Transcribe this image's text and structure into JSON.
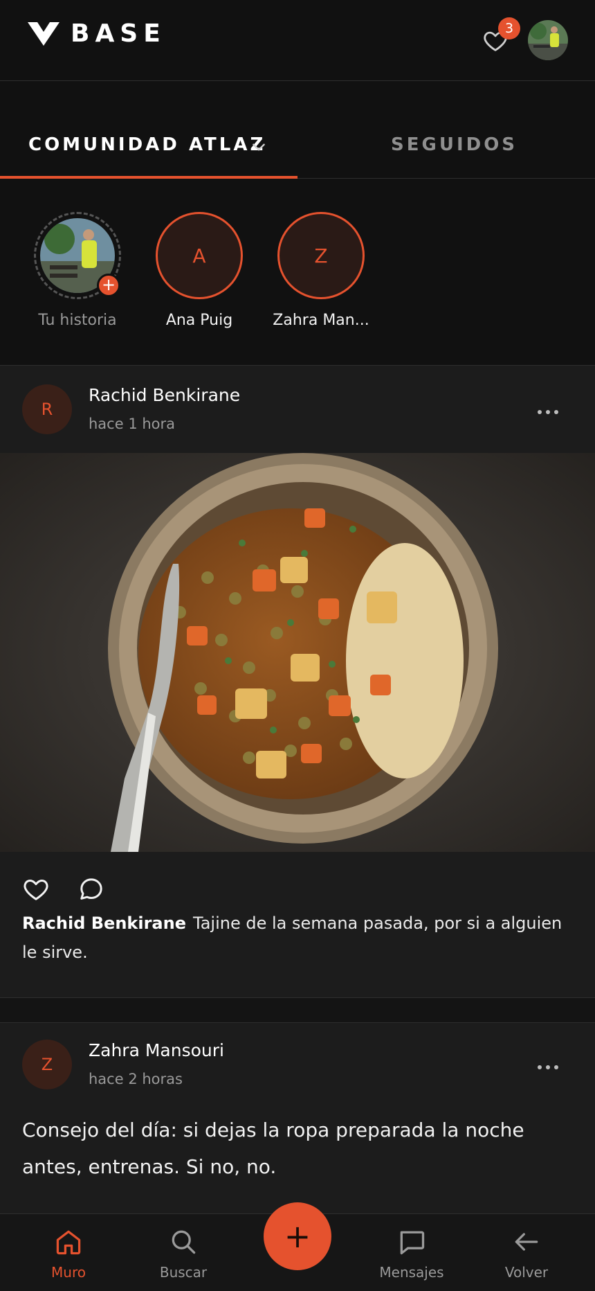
{
  "app": {
    "logo_text": "BASE",
    "notification_count": "3",
    "accent": "#e5522e"
  },
  "tabs": {
    "active_label": "COMUNIDAD ATLAZ",
    "other_label": "SEGUIDOS"
  },
  "stories": [
    {
      "label": "Tu historia",
      "initial": ""
    },
    {
      "label": "Ana Puig",
      "initial": "A"
    },
    {
      "label": "Zahra Man...",
      "initial": "Z"
    }
  ],
  "posts": [
    {
      "initial": "R",
      "author": "Rachid Benkirane",
      "time": "hace 1 hora",
      "caption_author": "Rachid Benkirane",
      "caption": "Tajine de la semana pasada, por si a alguien le sirve."
    },
    {
      "initial": "Z",
      "author": "Zahra Mansouri",
      "time": "hace 2 horas",
      "text": "Consejo del día: si dejas la ropa preparada la noche antes, entrenas. Si no, no."
    }
  ],
  "nav": {
    "home": "Muro",
    "search": "Buscar",
    "create": "+",
    "messages": "Mensajes",
    "back": "Volver"
  }
}
